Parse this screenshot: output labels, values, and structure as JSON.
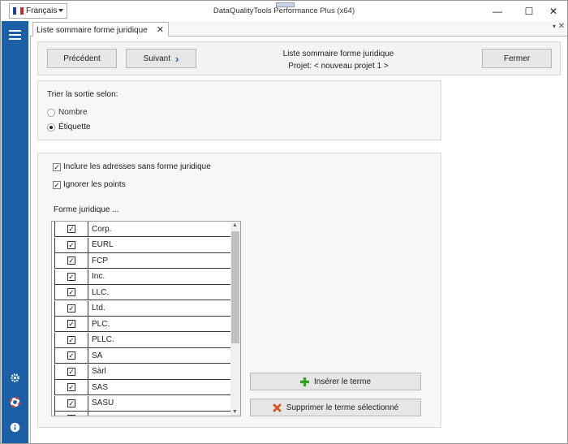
{
  "language_selector": {
    "value": "Français",
    "flag_colors": [
      "#1f3f9a",
      "#ffffff",
      "#d22630"
    ]
  },
  "app_title": "DataQualityTools Performance Plus (x64)",
  "window_controls": {
    "minimize": "—",
    "maximize": "☐",
    "close": "✕"
  },
  "tab": {
    "label": "Liste sommaire forme juridique",
    "close": "✕"
  },
  "toolbar": {
    "prev_label": "Précédent",
    "next_label": "Suivant",
    "next_chevron": "›",
    "title_line1": "Liste sommaire forme juridique",
    "title_line2": "Projet: < nouveau projet 1 >",
    "close_label": "Fermer"
  },
  "sort": {
    "label": "Trier la sortie selon:",
    "options": [
      {
        "label": "Nombre",
        "selected": false
      },
      {
        "label": "Étiquette",
        "selected": true
      }
    ]
  },
  "options": {
    "include_no_legal_form": "Inclure les adresses sans forme juridique",
    "ignore_dots": "Ignorer les points",
    "list_label": "Forme juridique ..."
  },
  "legal_forms": [
    {
      "label": "Corp.",
      "checked": true
    },
    {
      "label": "EURL",
      "checked": true
    },
    {
      "label": "FCP",
      "checked": true
    },
    {
      "label": "Inc.",
      "checked": true
    },
    {
      "label": "LLC.",
      "checked": true
    },
    {
      "label": "Ltd.",
      "checked": true
    },
    {
      "label": "PLC.",
      "checked": true
    },
    {
      "label": "PLLC.",
      "checked": true
    },
    {
      "label": "SA",
      "checked": true
    },
    {
      "label": "Sàrl",
      "checked": true
    },
    {
      "label": "SAS",
      "checked": true
    },
    {
      "label": "SASU",
      "checked": true
    },
    {
      "label": "SCA",
      "checked": true
    }
  ],
  "actions": {
    "insert_label": "Insérer le terme",
    "delete_label": "Supprimer le terme sélectionné"
  },
  "colors": {
    "sidebar": "#1b5fa6",
    "insert_icon": "#3a9a2a",
    "delete_icon": "#d9541e"
  }
}
